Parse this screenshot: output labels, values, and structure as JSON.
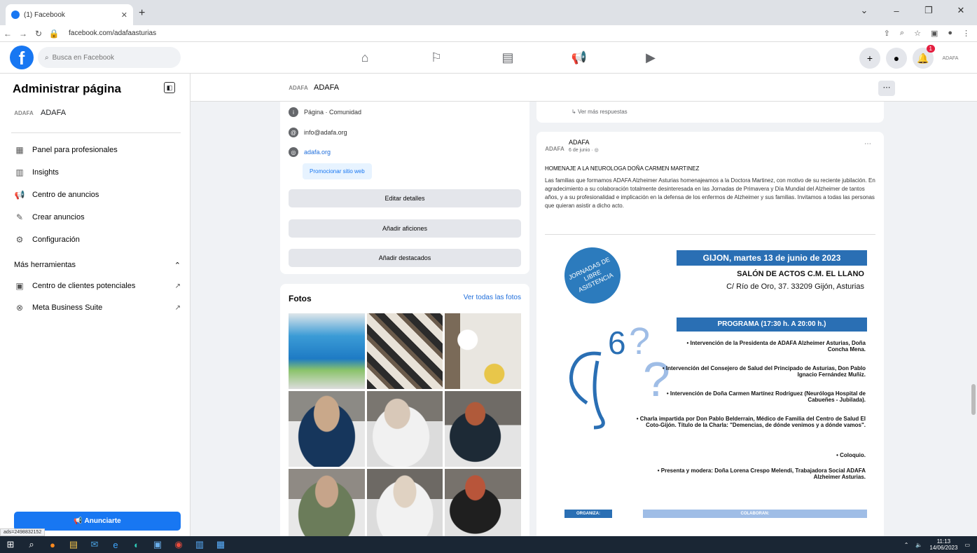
{
  "browser": {
    "tab_title": "(1) Facebook",
    "url": "facebook.com/adafaasturias"
  },
  "fb": {
    "search_placeholder": "Busca en Facebook",
    "notif_count": "1"
  },
  "sidebar": {
    "title": "Administrar página",
    "page_name": "ADAFA",
    "items": [
      {
        "label": "Panel para profesionales"
      },
      {
        "label": "Insights"
      },
      {
        "label": "Centro de anuncios"
      },
      {
        "label": "Crear anuncios"
      },
      {
        "label": "Configuración"
      }
    ],
    "more_tools": "Más herramientas",
    "tools": [
      {
        "label": "Centro de clientes potenciales"
      },
      {
        "label": "Meta Business Suite"
      }
    ],
    "advertise_button": "Anunciarte",
    "status_url": "ads=2498832152"
  },
  "page": {
    "name": "ADAFA",
    "logo_text": "ADAFA"
  },
  "info": {
    "category": "Página · Comunidad",
    "email": "info@adafa.org",
    "website": "adafa.org",
    "promote": "Promocionar sitio web",
    "edit_details": "Editar detalles",
    "add_hobbies": "Añadir aficiones",
    "add_featured": "Añadir destacados"
  },
  "photos": {
    "title": "Fotos",
    "see_all": "Ver todas las fotos"
  },
  "feed": {
    "more_replies": "Ver más respuestas"
  },
  "post": {
    "author": "ADAFA",
    "date": "6 de junio ·",
    "title": "HOMENAJE A LA NEUROLOGA DOÑA CARMEN MARTINEZ",
    "body": "Las familias que formamos ADAFA Alzheimer Asturias homenajeamos a la Doctora Martinez, con motivo de su reciente jubilación. En agradecimiento a su colaboración totalmente desinteresada en las Jornadas de Primavera y Día Mundial del Alzheimer de tantos años, y a su profesionalidad e implicación en la defensa de los enfermos de Alzheimer y sus familias. Invitamos a todas las personas que quieran asistir a dicho acto.",
    "poster": {
      "badge": "JORNADAS DE LIBRE ASISTENCIA",
      "date_bar": "GIJON, martes 13 de junio de 2023",
      "venue": "SALÓN DE ACTOS C.M. EL LLANO",
      "address": "C/ Río de Oro, 37. 33209 Gijón, Asturias",
      "program_bar": "PROGRAMA (17:30 h. A 20:00 h.)",
      "program": [
        "• Intervención de la Presidenta de ADAFA Alzheimer Asturias, Doña Concha Mena.",
        "• Intervención del Consejero de Salud del Principado de Asturias, Don Pablo Ignacio Fernández Muñiz.",
        "• Intervención de Doña Carmen Martínez Rodríguez (Neuróloga Hospital de Cabueñes - Jubilada).",
        "• Charla impartida por Don Pablo Belderrain, Médico de Familia del Centro de Salud El Coto-Gijón. Título de la Charla: \"Demencias, de dónde venimos y a dónde vamos\".",
        "• Coloquio.",
        "• Presenta y modera: Doña Lorena Crespo Melendi, Trabajadora Social ADAFA Alzheimer Asturias."
      ],
      "organiza": "ORGANIZA:",
      "colaboran": "COLABORAN:"
    }
  },
  "taskbar": {
    "time": "11:13",
    "date": "14/06/2023"
  },
  "colors": {
    "accent": "#1877f2",
    "poster_blue": "#2a6fb4"
  }
}
